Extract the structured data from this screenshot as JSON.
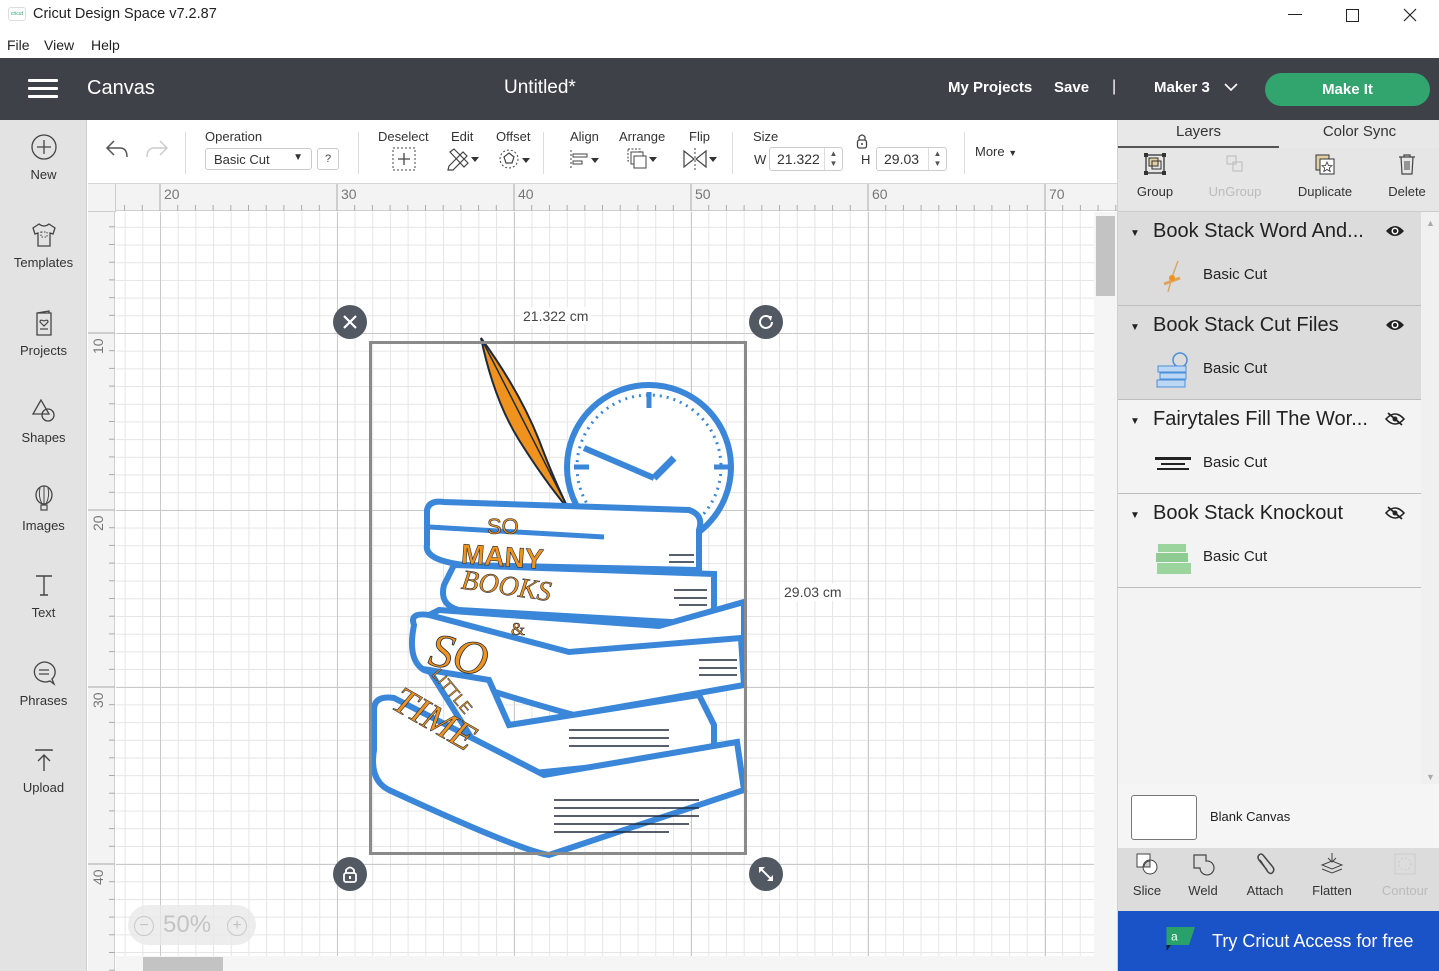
{
  "window": {
    "logo_text": "cricut",
    "title": "Cricut Design Space  v7.2.87",
    "controls": {
      "minimize": "—",
      "maximize": "☐",
      "close": "✕"
    }
  },
  "menubar": {
    "items": [
      "File",
      "View",
      "Help"
    ]
  },
  "header": {
    "section": "Canvas",
    "document_title": "Untitled*",
    "my_projects": "My Projects",
    "save": "Save",
    "separator": "|",
    "machine": "Maker 3",
    "make_it": "Make It"
  },
  "sidebar": {
    "items": [
      {
        "label": "New",
        "icon": "plus-circle-icon"
      },
      {
        "label": "Templates",
        "icon": "tshirt-icon"
      },
      {
        "label": "Projects",
        "icon": "card-heart-icon"
      },
      {
        "label": "Shapes",
        "icon": "shapes-icon"
      },
      {
        "label": "Images",
        "icon": "balloon-icon"
      },
      {
        "label": "Text",
        "icon": "text-icon"
      },
      {
        "label": "Phrases",
        "icon": "speech-bubble-icon"
      },
      {
        "label": "Upload",
        "icon": "upload-icon"
      }
    ]
  },
  "toolbar": {
    "operation_label": "Operation",
    "operation_value": "Basic Cut",
    "help": "?",
    "deselect": "Deselect",
    "edit": "Edit",
    "offset": "Offset",
    "align": "Align",
    "arrange": "Arrange",
    "flip": "Flip",
    "size_label": "Size",
    "w_label": "W",
    "w_value": "21.322",
    "h_label": "H",
    "h_value": "29.03",
    "more": "More"
  },
  "rulers": {
    "top": [
      "20",
      "30",
      "40",
      "50",
      "60",
      "70"
    ],
    "left": [
      "10",
      "20",
      "30",
      "40"
    ]
  },
  "canvas": {
    "width_readout": "21.322 cm",
    "height_readout": "29.03 cm",
    "zoom": "50%",
    "zoom_minus": "−",
    "zoom_plus": "+",
    "artwork_text": [
      "SO",
      "MANY",
      "BOOKS",
      "&",
      "SO",
      "LITTLE",
      "TIME"
    ],
    "colors": {
      "outline": "#3a86d8",
      "text": "#f0931e",
      "ink": "#1e2a3a"
    }
  },
  "right_panel": {
    "tabs": [
      "Layers",
      "Color Sync"
    ],
    "tools": [
      {
        "label": "Group",
        "enabled": true
      },
      {
        "label": "UnGroup",
        "enabled": false
      },
      {
        "label": "Duplicate",
        "enabled": true
      },
      {
        "label": "Delete",
        "enabled": true
      }
    ],
    "layers": [
      {
        "name": "Book Stack Word And...",
        "operation": "Basic Cut",
        "visible": true
      },
      {
        "name": "Book Stack Cut Files",
        "operation": "Basic Cut",
        "visible": true
      },
      {
        "name": "Fairytales Fill The Wor...",
        "operation": "Basic Cut",
        "visible": false
      },
      {
        "name": "Book Stack Knockout",
        "operation": "Basic Cut",
        "visible": false
      }
    ],
    "blank_canvas": "Blank Canvas",
    "bottom_tools": [
      {
        "label": "Slice",
        "enabled": true
      },
      {
        "label": "Weld",
        "enabled": true
      },
      {
        "label": "Attach",
        "enabled": true
      },
      {
        "label": "Flatten",
        "enabled": true
      },
      {
        "label": "Contour",
        "enabled": false
      }
    ],
    "access_logo": "a",
    "access_banner": "Try Cricut Access for free"
  }
}
